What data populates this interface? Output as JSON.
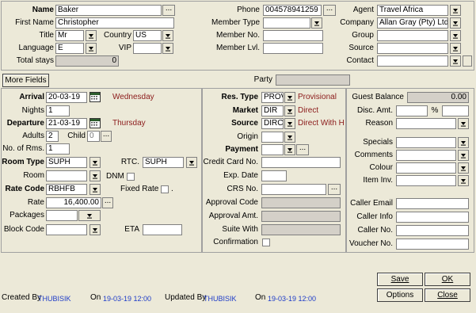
{
  "top": {
    "name_label": "Name",
    "name_value": "Baker",
    "first_name_label": "First Name",
    "first_name_value": "Christopher",
    "title_label": "Title",
    "title_value": "Mr",
    "country_label": "Country",
    "country_value": "US",
    "language_label": "Language",
    "language_value": "E",
    "vip_label": "VIP",
    "vip_value": "",
    "total_stays_label": "Total stays",
    "total_stays_value": "0",
    "phone_label": "Phone",
    "phone_value": "004578941259",
    "member_type_label": "Member Type",
    "member_type_value": "",
    "member_no_label": "Member No.",
    "member_no_value": "",
    "member_lvl_label": "Member Lvl.",
    "member_lvl_value": "",
    "agent_label": "Agent",
    "agent_value": "Travel Africa",
    "company_label": "Company",
    "company_value": "Allan Gray (Pty) Ltd",
    "group_label": "Group",
    "group_value": "",
    "source_label": "Source",
    "source_value": "",
    "contact_label": "Contact",
    "contact_value": ""
  },
  "bar": {
    "more_fields_label": "More Fields",
    "party_label": "Party",
    "party_value": ""
  },
  "left": {
    "arrival_label": "Arrival",
    "arrival_value": "20-03-19",
    "arrival_day": "Wednesday",
    "nights_label": "Nights",
    "nights_value": "1",
    "departure_label": "Departure",
    "departure_value": "21-03-19",
    "departure_day": "Thursday",
    "adults_label": "Adults",
    "adults_value": "2",
    "child_label": "Child",
    "child_value": "0",
    "rooms_label": "No. of Rms.",
    "rooms_value": "1",
    "room_type_label": "Room Type",
    "room_type_value": "SUPH",
    "rtc_label": "RTC.",
    "rtc_value": "SUPH",
    "room_label": "Room",
    "room_value": "",
    "dnm_label": "DNM",
    "rate_code_label": "Rate Code",
    "rate_code_value": "RBHFB",
    "fixed_rate_label": "Fixed Rate",
    "fixed_rate_suffix": ".",
    "rate_label": "Rate",
    "rate_value": "16,400.00",
    "packages_label": "Packages",
    "packages_value": "",
    "block_code_label": "Block Code",
    "block_code_value": "",
    "eta_label": "ETA",
    "eta_value": ""
  },
  "middle": {
    "res_type_label": "Res. Type",
    "res_type_value": "PROV",
    "res_type_desc": "Provisional",
    "market_label": "Market",
    "market_value": "DIR",
    "market_desc": "Direct",
    "source_label": "Source",
    "source_value": "DIRC",
    "source_desc": "Direct With H",
    "origin_label": "Origin",
    "origin_value": "",
    "payment_label": "Payment",
    "payment_value": "",
    "cc_label": "Credit Card No.",
    "cc_value": "",
    "exp_label": "Exp. Date",
    "exp_value": "",
    "crs_label": "CRS No.",
    "crs_value": "",
    "approval_code_label": "Approval Code",
    "approval_code_value": "",
    "approval_amt_label": "Approval Amt.",
    "approval_amt_value": "",
    "suite_with_label": "Suite With",
    "suite_with_value": "",
    "confirmation_label": "Confirmation"
  },
  "right": {
    "guest_balance_label": "Guest Balance",
    "guest_balance_value": "0.00",
    "disc_amt_label": "Disc. Amt.",
    "disc_amt_value": "",
    "percent_label": "%",
    "percent_value": "",
    "reason_label": "Reason",
    "reason_value": "",
    "specials_label": "Specials",
    "comments_label": "Comments",
    "colour_label": "Colour",
    "item_inv_label": "Item Inv.",
    "caller_email_label": "Caller Email",
    "caller_info_label": "Caller Info",
    "caller_no_label": "Caller No.",
    "voucher_no_label": "Voucher No."
  },
  "buttons": {
    "save": "Save",
    "ok": "OK",
    "options": "Options",
    "close": "Close"
  },
  "footer": {
    "created_by_label": "Created By",
    "created_by_value": "THUBISIK",
    "created_on_label": "On",
    "created_on_value": "19-03-19 12:00",
    "updated_by_label": "Updated By",
    "updated_by_value": "THUBISIK",
    "updated_on_label": "On",
    "updated_on_value": "19-03-19 12:00"
  }
}
